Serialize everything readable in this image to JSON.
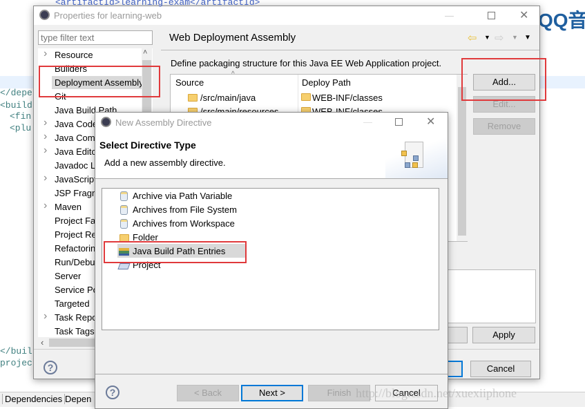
{
  "editor": {
    "lines": [
      "<artifactId>learning-exam</artifactId>",
      "</depe",
      "<build",
      "<fin",
      "<plu",
      "</buil",
      "project"
    ],
    "tabs": [
      "Dependencies",
      "Depen"
    ]
  },
  "logo_text": "QQ音",
  "watermark": "http://blog.csdn.net/xuexiiphone",
  "properties": {
    "title": "Properties for learning-web",
    "filter_placeholder": "type filter text",
    "tree": [
      {
        "label": "Resource",
        "expandable": true
      },
      {
        "label": "Builders",
        "expandable": false
      },
      {
        "label": "Deployment Assembly",
        "expandable": false,
        "selected": true
      },
      {
        "label": "Git",
        "expandable": false
      },
      {
        "label": "Java Build Path",
        "expandable": false
      },
      {
        "label": "Java Code",
        "expandable": true
      },
      {
        "label": "Java Comp",
        "expandable": true
      },
      {
        "label": "Java Edito",
        "expandable": true
      },
      {
        "label": "Javadoc L",
        "expandable": false
      },
      {
        "label": "JavaScript",
        "expandable": true
      },
      {
        "label": "JSP Fragm",
        "expandable": false
      },
      {
        "label": "Maven",
        "expandable": true
      },
      {
        "label": "Project Fa",
        "expandable": false
      },
      {
        "label": "Project Re",
        "expandable": false
      },
      {
        "label": "Refactorin",
        "expandable": false
      },
      {
        "label": "Run/Debu",
        "expandable": false
      },
      {
        "label": "Server",
        "expandable": false
      },
      {
        "label": "Service Po",
        "expandable": false
      },
      {
        "label": "Targeted",
        "expandable": false
      },
      {
        "label": "Task Repo",
        "expandable": true
      },
      {
        "label": "Task Tags",
        "expandable": false
      }
    ],
    "page_title": "Web Deployment Assembly",
    "description": "Define packaging structure for this Java EE Web Application project.",
    "table": {
      "headers": [
        "Source",
        "Deploy Path"
      ],
      "rows": [
        [
          "/src/main/java",
          "WEB-INF/classes"
        ],
        [
          "/src/main/resources",
          "WEB-INF/classes"
        ]
      ]
    },
    "buttons": {
      "add": "Add...",
      "edit": "Edit...",
      "remove": "Remove",
      "restore": "t",
      "apply": "Apply",
      "cancel": "Cancel"
    }
  },
  "directive": {
    "title": "New Assembly Directive",
    "heading": "Select Directive Type",
    "subheading": "Add a new assembly directive.",
    "items": [
      {
        "label": "Archive via Path Variable",
        "icon": "jar-icon"
      },
      {
        "label": "Archives from File System",
        "icon": "jar-icon"
      },
      {
        "label": "Archives from Workspace",
        "icon": "jar-icon"
      },
      {
        "label": "Folder",
        "icon": "folder-icon"
      },
      {
        "label": "Java Build Path Entries",
        "icon": "library-icon",
        "selected": true
      },
      {
        "label": "Project",
        "icon": "project-icon"
      }
    ],
    "buttons": {
      "back": "< Back",
      "next": "Next >",
      "finish": "Finish",
      "cancel": "Cancel"
    }
  },
  "colors": {
    "highlight": "#e0393b",
    "focus": "#0078d7"
  }
}
